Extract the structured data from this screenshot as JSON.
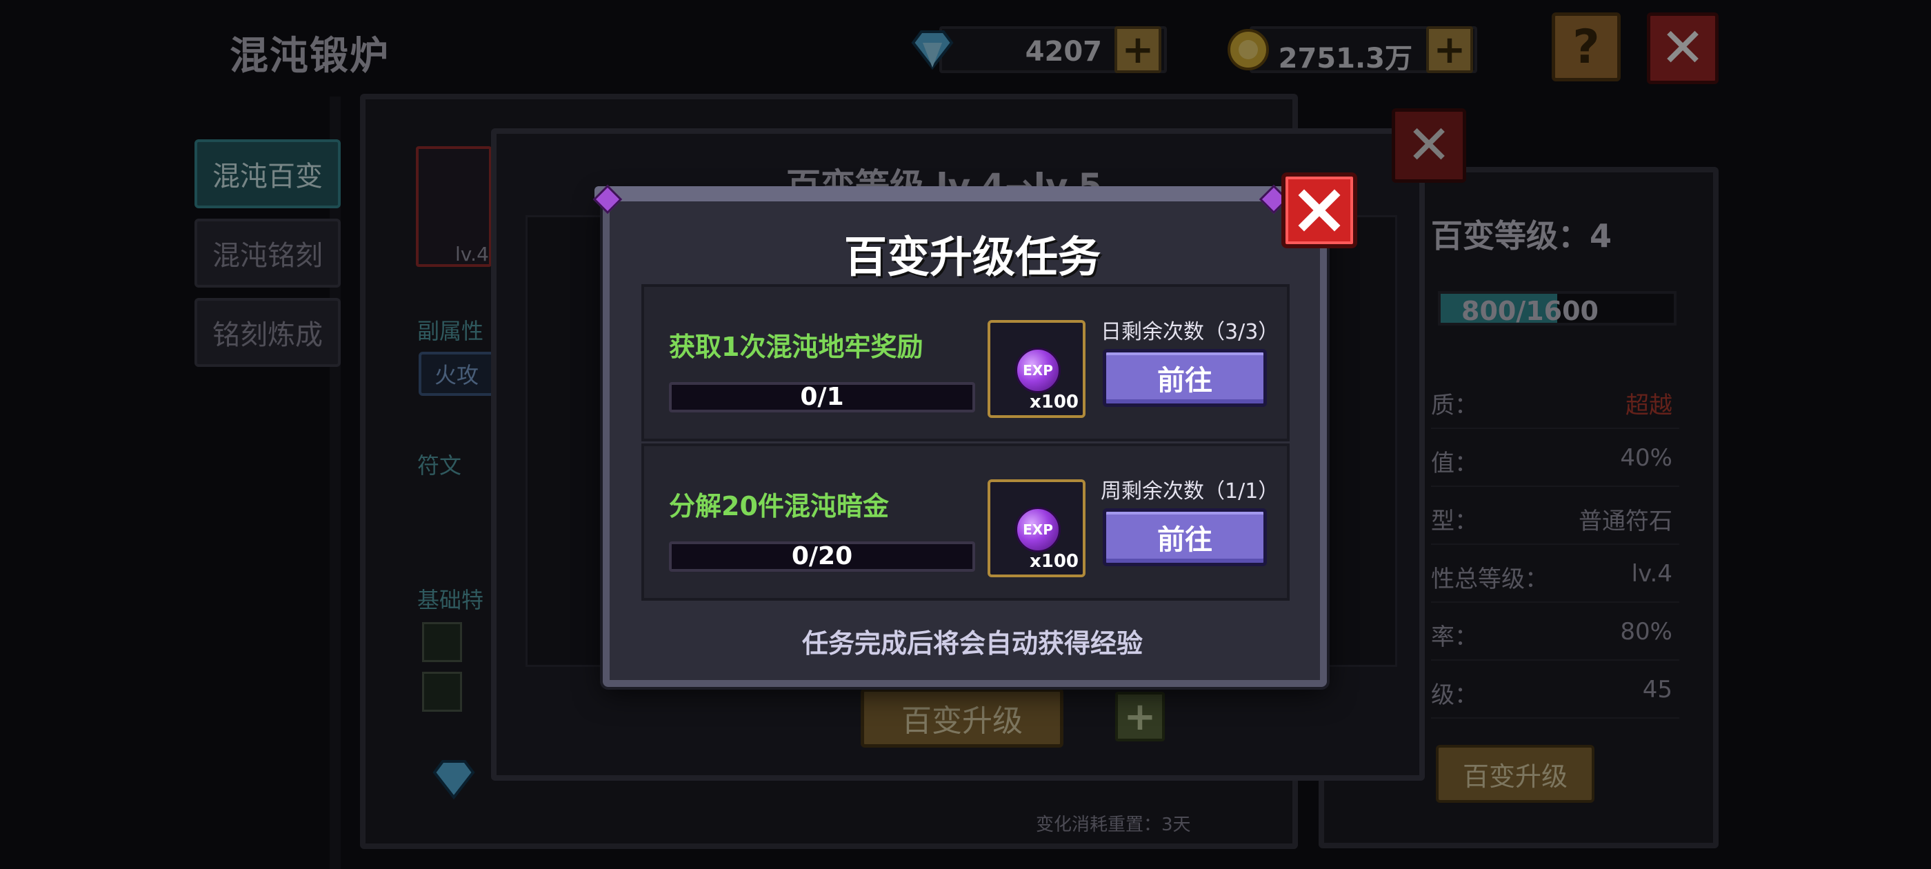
{
  "header": {
    "title": "混沌锻炉",
    "diamonds": "4207",
    "gold": "2751.3万",
    "help_label": "?"
  },
  "sidebar": {
    "items": [
      {
        "label": "混沌百变",
        "active": true
      },
      {
        "label": "混沌铭刻",
        "active": false
      },
      {
        "label": "铭刻炼成",
        "active": false
      }
    ]
  },
  "left_panel": {
    "char_level": "lv.4",
    "sub_attr_label": "副属性",
    "attr_chip": "火攻",
    "rune_label": "符文",
    "base_label": "基础特"
  },
  "middle_panel": {
    "title": "百变等级 lv.4→lv.5",
    "upgrade_label": "百变升级"
  },
  "right_panel": {
    "level_title": "百变等级：4",
    "xp_text": "800/1600",
    "xp_fraction": 0.5,
    "stats": [
      {
        "key": "质：",
        "value": "超越",
        "color": "#c0392b"
      },
      {
        "key": "值：",
        "value": "40%",
        "color": "#9a98aa"
      },
      {
        "key": "型：",
        "value": "普通符石",
        "color": "#9a98aa"
      },
      {
        "key": "性总等级：",
        "value": "lv.4",
        "color": "#9a98aa"
      },
      {
        "key": "率：",
        "value": "80%",
        "color": "#9a98aa"
      },
      {
        "key": "级：",
        "value": "45",
        "color": "#9a98aa"
      }
    ],
    "upgrade_label": "百变升级",
    "reset_note": "变化消耗重置：3天"
  },
  "dialog": {
    "title": "百变升级任务",
    "tasks": [
      {
        "name": "获取1次混沌地牢奖励",
        "progress_text": "0/1",
        "progress": 0,
        "reward_icon": "EXP",
        "reward_qty": "x100",
        "remaining": "日剩余次数（3/3）",
        "button": "前往"
      },
      {
        "name": "分解20件混沌暗金",
        "progress_text": "0/20",
        "progress": 0,
        "reward_icon": "EXP",
        "reward_qty": "x100",
        "remaining": "周剩余次数（1/1）",
        "button": "前往"
      }
    ],
    "footer": "任务完成后将会自动获得经验"
  },
  "icons": {
    "diamond": "diamond-icon",
    "gold": "gold-coin-icon",
    "close": "close-icon",
    "help": "help-icon",
    "plus": "plus-icon",
    "exp_orb": "exp-orb-icon"
  },
  "colors": {
    "task_name": "#7ed957",
    "go_button": "#7c6fd0",
    "close_button": "#d02323",
    "active_tab": "#1f5a63"
  }
}
